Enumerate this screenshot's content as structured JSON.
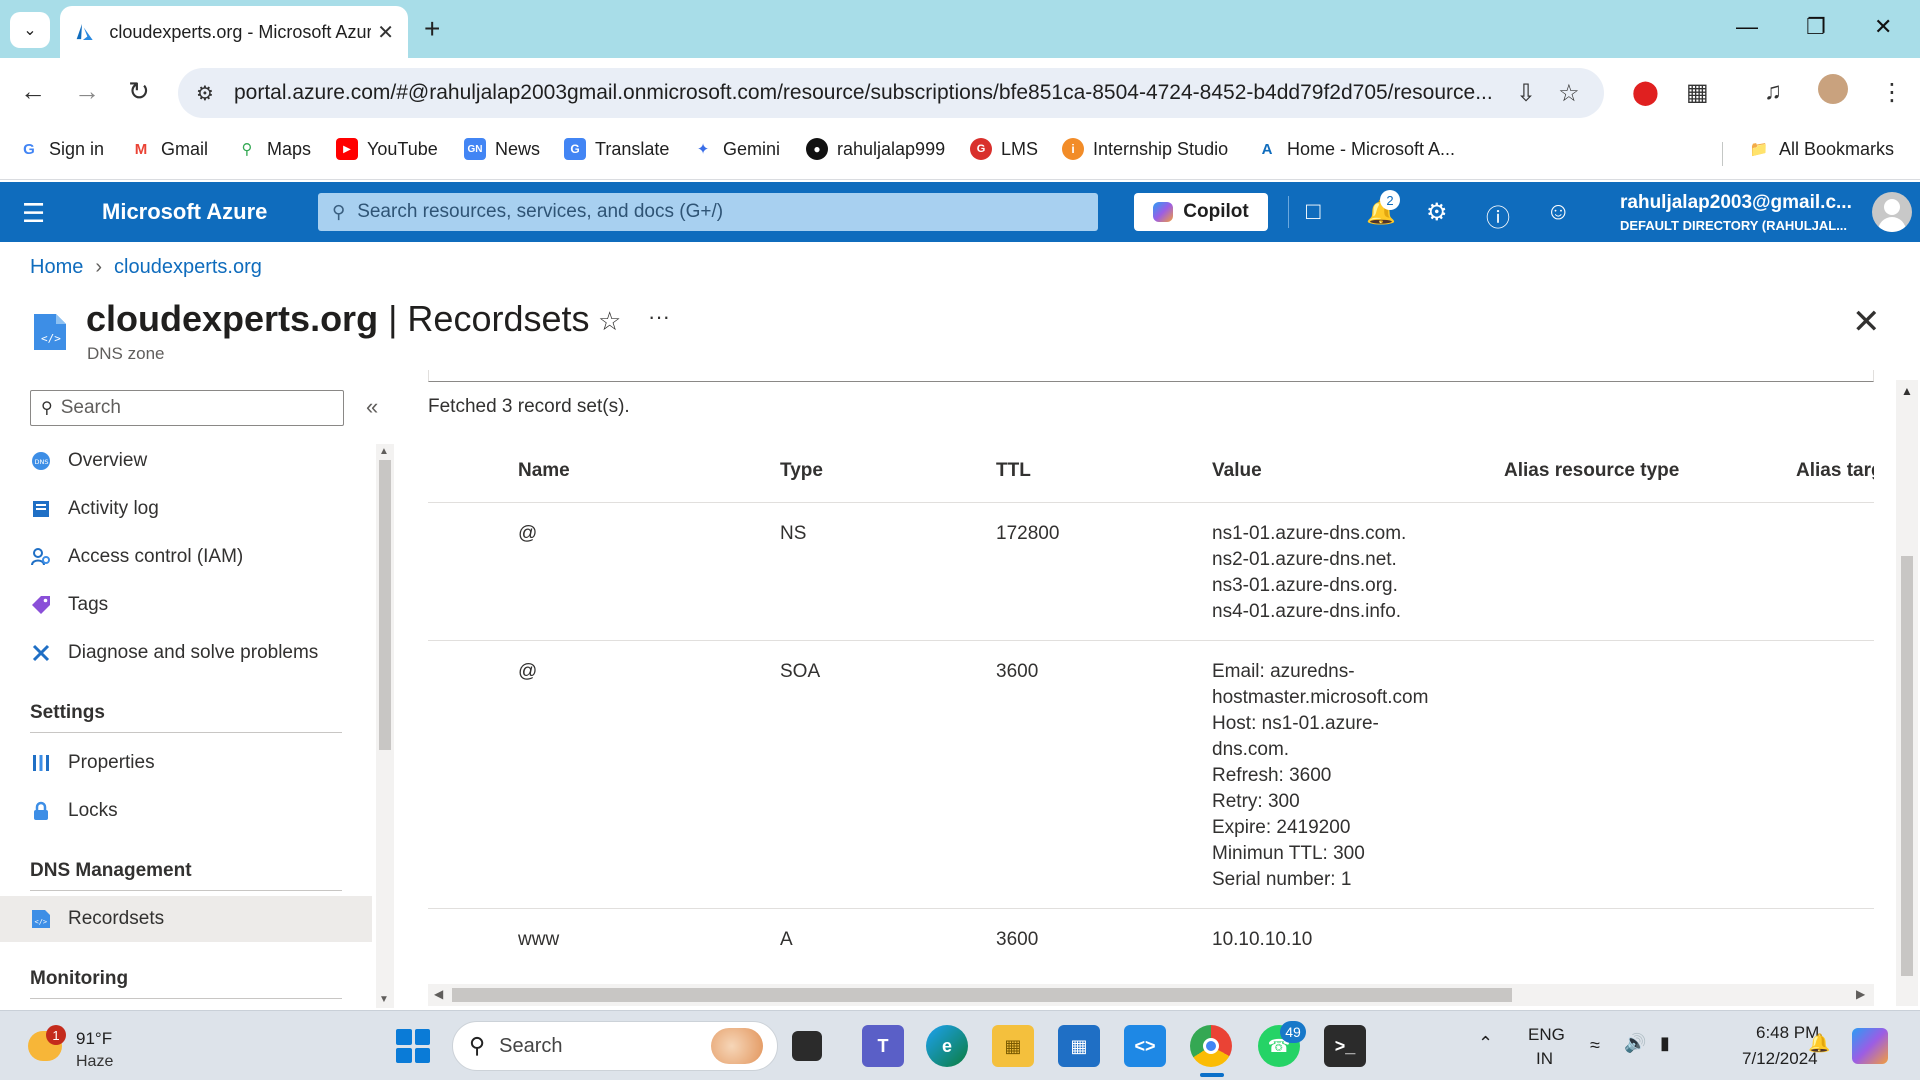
{
  "browser": {
    "tab_title": "cloudexperts.org - Microsoft Azure",
    "url": "portal.azure.com/#@rahuljalap2003gmail.onmicrosoft.com/resource/subscriptions/bfe851ca-8504-4724-8452-b4dd79f2d705/resource..."
  },
  "bookmarks": [
    {
      "label": "Sign in",
      "icon": "google-icon",
      "color": "#4285f4"
    },
    {
      "label": "Gmail",
      "icon": "gmail-icon",
      "color": "#ea4335"
    },
    {
      "label": "Maps",
      "icon": "maps-icon",
      "color": "#34a853"
    },
    {
      "label": "YouTube",
      "icon": "youtube-icon",
      "color": "#ff0000"
    },
    {
      "label": "News",
      "icon": "news-icon",
      "color": "#4285f4"
    },
    {
      "label": "Translate",
      "icon": "translate-icon",
      "color": "#4285f4"
    },
    {
      "label": "Gemini",
      "icon": "gemini-icon",
      "color": "#3a6ee8"
    },
    {
      "label": "rahuljalap999",
      "icon": "github-icon",
      "color": "#111111"
    },
    {
      "label": "LMS",
      "icon": "lms-icon",
      "color": "#d9302c"
    },
    {
      "label": "Internship Studio",
      "icon": "internship-studio-icon",
      "color": "#f28c28"
    },
    {
      "label": "Home - Microsoft A...",
      "icon": "azure-icon",
      "color": "#0f6cbd"
    }
  ],
  "all_bookmarks_label": "All Bookmarks",
  "azure": {
    "brand": "Microsoft Azure",
    "search_placeholder": "Search resources, services, and docs (G+/)",
    "copilot_label": "Copilot",
    "notification_count": "2",
    "account_name": "rahuljalap2003@gmail.c...",
    "account_directory": "DEFAULT DIRECTORY (RAHULJAL...",
    "accent_color": "#0f6cbd"
  },
  "breadcrumb": {
    "home": "Home",
    "current": "cloudexperts.org"
  },
  "header": {
    "resource_name": "cloudexperts.org",
    "separator": " | ",
    "blade_name": "Recordsets",
    "subtitle": "DNS zone"
  },
  "nav": {
    "search_placeholder": "Search",
    "items_top": [
      {
        "label": "Overview",
        "icon": "dns-overview-icon"
      },
      {
        "label": "Activity log",
        "icon": "activity-log-icon"
      },
      {
        "label": "Access control (IAM)",
        "icon": "iam-icon"
      },
      {
        "label": "Tags",
        "icon": "tag-icon"
      },
      {
        "label": "Diagnose and solve problems",
        "icon": "diagnose-icon"
      }
    ],
    "group_settings": "Settings",
    "items_settings": [
      {
        "label": "Properties",
        "icon": "properties-icon"
      },
      {
        "label": "Locks",
        "icon": "lock-icon"
      }
    ],
    "group_dns": "DNS Management",
    "items_dns": [
      {
        "label": "Recordsets",
        "icon": "recordsets-icon",
        "selected": true
      }
    ],
    "group_monitoring": "Monitoring"
  },
  "content": {
    "fetched_text": "Fetched 3 record set(s).",
    "columns": [
      "Name",
      "Type",
      "TTL",
      "Value",
      "Alias resource type",
      "Alias targ"
    ],
    "rows": [
      {
        "name": "@",
        "type": "NS",
        "ttl": "172800",
        "value": [
          "ns1-01.azure-dns.com.",
          "ns2-01.azure-dns.net.",
          "ns3-01.azure-dns.org.",
          "ns4-01.azure-dns.info."
        ]
      },
      {
        "name": "@",
        "type": "SOA",
        "ttl": "3600",
        "value": [
          "Email: azuredns-",
          "hostmaster.microsoft.com",
          "Host: ns1-01.azure-",
          "dns.com.",
          "Refresh: 3600",
          "Retry: 300",
          "Expire: 2419200",
          "Minimun TTL: 300",
          "Serial number: 1"
        ]
      },
      {
        "name": "www",
        "type": "A",
        "ttl": "3600",
        "value": [
          "10.10.10.10"
        ]
      }
    ]
  },
  "taskbar": {
    "weather_badge": "1",
    "temperature": "91°F",
    "condition": "Haze",
    "search_label": "Search",
    "whatsapp_badge": "49",
    "lang_line1": "ENG",
    "lang_line2": "IN",
    "time": "6:48 PM",
    "date": "7/12/2024"
  }
}
